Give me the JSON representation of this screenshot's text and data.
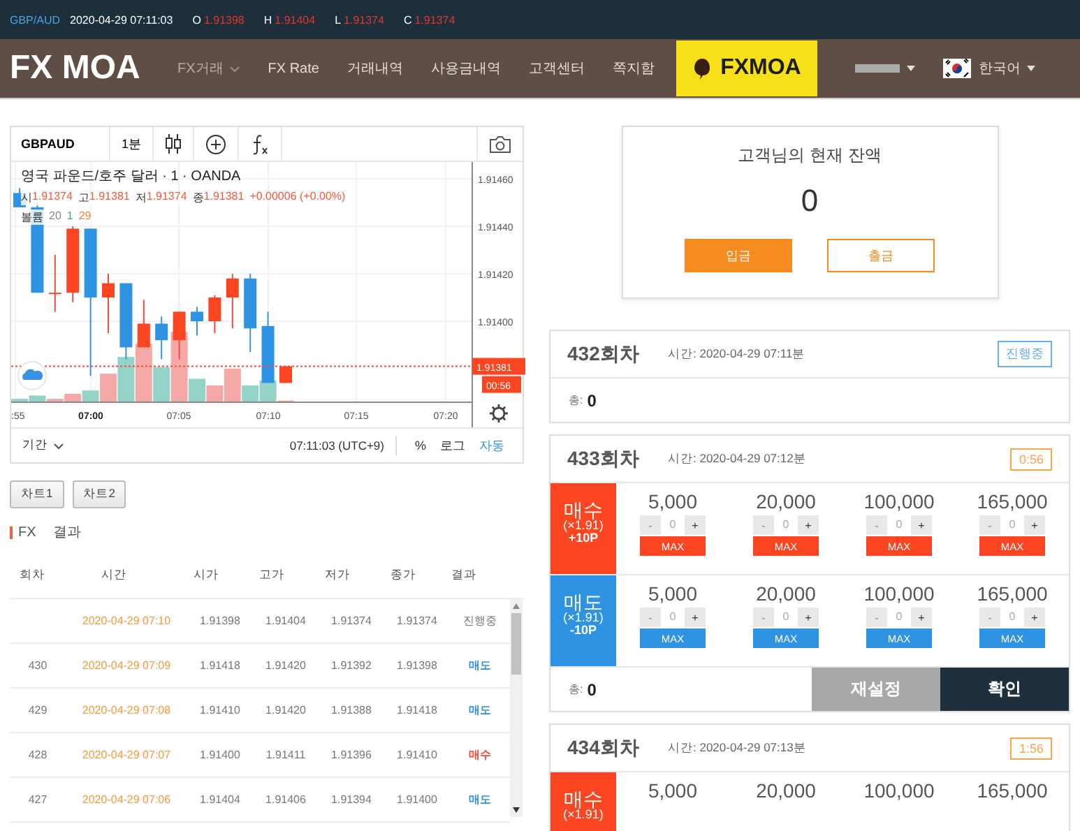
{
  "ticker": {
    "symbol": "GBP/AUD",
    "datetime": "2020-04-29 07:11:03",
    "quotes": [
      {
        "label": "O",
        "value": "1.91398"
      },
      {
        "label": "H",
        "value": "1.91404"
      },
      {
        "label": "L",
        "value": "1.91374"
      },
      {
        "label": "C",
        "value": "1.91374"
      }
    ]
  },
  "nav": {
    "logo": "FX MOA",
    "items": [
      {
        "label": "FX거래",
        "dropdown": true
      },
      {
        "label": "FX Rate",
        "dropdown": false
      },
      {
        "label": "거래내역",
        "dropdown": false
      },
      {
        "label": "사용금내역",
        "dropdown": false
      },
      {
        "label": "고객센터",
        "dropdown": false
      },
      {
        "label": "쪽지함",
        "dropdown": false
      }
    ],
    "banner": "FXMOA",
    "language": "한국어"
  },
  "chart": {
    "symbol": "GBPAUD",
    "interval": "1분",
    "title": "영국 파운드/호주 달러 · 1 · OANDA",
    "ohlc": [
      {
        "label": "시",
        "value": "1.91374"
      },
      {
        "label": "고",
        "value": "1.91381"
      },
      {
        "label": "저",
        "value": "1.91374"
      },
      {
        "label": "종",
        "value": "1.91381"
      }
    ],
    "change": "+0.00006 (+0.00%)",
    "volume": {
      "label": "볼륨",
      "values": [
        "20",
        "1",
        "29"
      ]
    },
    "price_ticks": [
      "1.91460",
      "1.91440",
      "1.91420",
      "1.91400"
    ],
    "time_ticks": [
      ":55",
      "07:00",
      "07:05",
      "07:10",
      "07:15",
      "07:20"
    ],
    "last_price": "1.91381",
    "countdown": "00:56",
    "period": "기간",
    "clock": "07:11:03 (UTC+9)",
    "scale_options": [
      {
        "label": "%",
        "selected": false
      },
      {
        "label": "로그",
        "selected": false
      },
      {
        "label": "자동",
        "selected": true
      }
    ]
  },
  "chart_tabs": [
    "차트1",
    "차트2"
  ],
  "results": {
    "title_prefix": "FX",
    "title": "결과",
    "columns": [
      "회차",
      "시간",
      "시가",
      "고가",
      "저가",
      "종가",
      "결과"
    ],
    "rows": [
      {
        "time": "2020-04-29 07:10",
        "open": "1.91398",
        "high": "1.91404",
        "low": "1.91374",
        "close": "1.91374",
        "result": "진행중",
        "kind": "pending"
      },
      {
        "round": "430",
        "time": "2020-04-29 07:09",
        "open": "1.91418",
        "high": "1.91420",
        "low": "1.91392",
        "close": "1.91398",
        "result": "매도",
        "kind": "sell"
      },
      {
        "round": "429",
        "time": "2020-04-29 07:08",
        "open": "1.91410",
        "high": "1.91420",
        "low": "1.91388",
        "close": "1.91418",
        "result": "매도",
        "kind": "sell"
      },
      {
        "round": "428",
        "time": "2020-04-29 07:07",
        "open": "1.91400",
        "high": "1.91411",
        "low": "1.91396",
        "close": "1.91410",
        "result": "매수",
        "kind": "buy"
      },
      {
        "round": "427",
        "time": "2020-04-29 07:06",
        "open": "1.91404",
        "high": "1.91406",
        "low": "1.91394",
        "close": "1.91400",
        "result": "매도",
        "kind": "sell"
      }
    ]
  },
  "balance": {
    "title": "고객님의 현재 잔액",
    "amount": "0",
    "deposit": "입금",
    "withdraw": "출금"
  },
  "rounds": [
    {
      "title": "432회차",
      "time_label": "시간:",
      "time": "2020-04-29 07:11분",
      "badge": "진행중",
      "color": "#6ab0e8",
      "total_label": "총:",
      "total": "0"
    },
    {
      "title": "433회차",
      "time_label": "시간:",
      "time": "2020-04-29 07:12분",
      "badge": "0:56",
      "color": "#f4a54c",
      "rows": [
        {
          "kind": "buy",
          "label": "매수",
          "rate": "(×1.91)",
          "points": "+10P",
          "amounts": [
            {
              "amount": "5,000",
              "minus": "-",
              "value": "0",
              "plus": "+",
              "max": "MAX"
            },
            {
              "amount": "20,000",
              "minus": "-",
              "value": "0",
              "plus": "+",
              "max": "MAX"
            },
            {
              "amount": "100,000",
              "minus": "-",
              "value": "0",
              "plus": "+",
              "max": "MAX"
            },
            {
              "amount": "165,000",
              "minus": "-",
              "value": "0",
              "plus": "+",
              "max": "MAX"
            }
          ]
        },
        {
          "kind": "sell",
          "label": "매도",
          "rate": "(×1.91)",
          "points": "-10P",
          "amounts": [
            {
              "amount": "5,000",
              "minus": "-",
              "value": "0",
              "plus": "+",
              "max": "MAX"
            },
            {
              "amount": "20,000",
              "minus": "-",
              "value": "0",
              "plus": "+",
              "max": "MAX"
            },
            {
              "amount": "100,000",
              "minus": "-",
              "value": "0",
              "plus": "+",
              "max": "MAX"
            },
            {
              "amount": "165,000",
              "minus": "-",
              "value": "0",
              "plus": "+",
              "max": "MAX"
            }
          ]
        }
      ],
      "total_label": "총:",
      "total": "0",
      "reset": "재설정",
      "confirm": "확인"
    },
    {
      "title": "434회차",
      "time_label": "시간:",
      "time": "2020-04-29 07:13분",
      "badge": "1:56",
      "color": "#f4a54c",
      "rows": [
        {
          "kind": "buy",
          "label": "매수",
          "rate": "(×1.91)",
          "amounts": [
            {
              "amount": "5,000"
            },
            {
              "amount": "20,000"
            },
            {
              "amount": "100,000"
            },
            {
              "amount": "165,000"
            }
          ]
        }
      ]
    }
  ]
}
